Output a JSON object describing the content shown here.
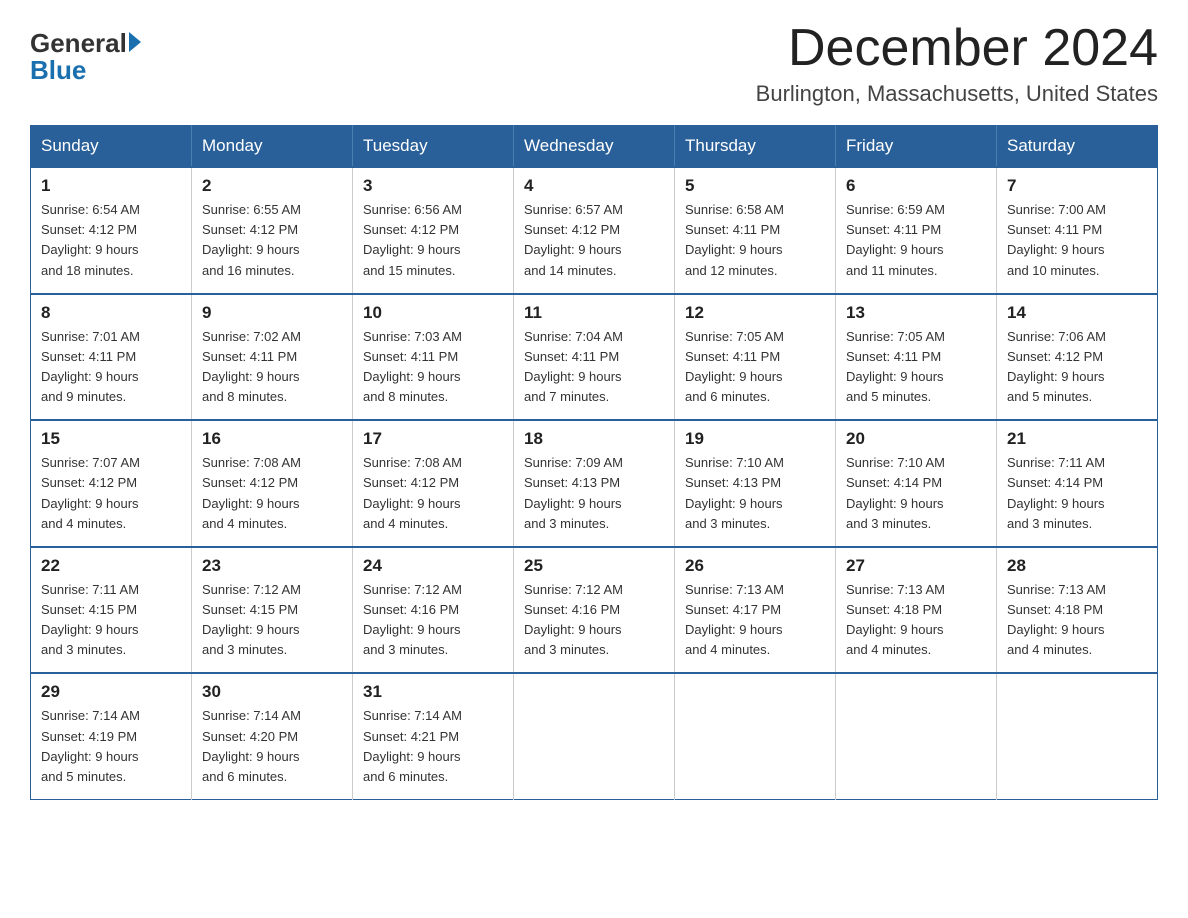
{
  "logo": {
    "general": "General",
    "blue": "Blue"
  },
  "title": "December 2024",
  "subtitle": "Burlington, Massachusetts, United States",
  "weekdays": [
    "Sunday",
    "Monday",
    "Tuesday",
    "Wednesday",
    "Thursday",
    "Friday",
    "Saturday"
  ],
  "weeks": [
    [
      {
        "day": "1",
        "sunrise": "6:54 AM",
        "sunset": "4:12 PM",
        "daylight": "9 hours and 18 minutes."
      },
      {
        "day": "2",
        "sunrise": "6:55 AM",
        "sunset": "4:12 PM",
        "daylight": "9 hours and 16 minutes."
      },
      {
        "day": "3",
        "sunrise": "6:56 AM",
        "sunset": "4:12 PM",
        "daylight": "9 hours and 15 minutes."
      },
      {
        "day": "4",
        "sunrise": "6:57 AM",
        "sunset": "4:12 PM",
        "daylight": "9 hours and 14 minutes."
      },
      {
        "day": "5",
        "sunrise": "6:58 AM",
        "sunset": "4:11 PM",
        "daylight": "9 hours and 12 minutes."
      },
      {
        "day": "6",
        "sunrise": "6:59 AM",
        "sunset": "4:11 PM",
        "daylight": "9 hours and 11 minutes."
      },
      {
        "day": "7",
        "sunrise": "7:00 AM",
        "sunset": "4:11 PM",
        "daylight": "9 hours and 10 minutes."
      }
    ],
    [
      {
        "day": "8",
        "sunrise": "7:01 AM",
        "sunset": "4:11 PM",
        "daylight": "9 hours and 9 minutes."
      },
      {
        "day": "9",
        "sunrise": "7:02 AM",
        "sunset": "4:11 PM",
        "daylight": "9 hours and 8 minutes."
      },
      {
        "day": "10",
        "sunrise": "7:03 AM",
        "sunset": "4:11 PM",
        "daylight": "9 hours and 8 minutes."
      },
      {
        "day": "11",
        "sunrise": "7:04 AM",
        "sunset": "4:11 PM",
        "daylight": "9 hours and 7 minutes."
      },
      {
        "day": "12",
        "sunrise": "7:05 AM",
        "sunset": "4:11 PM",
        "daylight": "9 hours and 6 minutes."
      },
      {
        "day": "13",
        "sunrise": "7:05 AM",
        "sunset": "4:11 PM",
        "daylight": "9 hours and 5 minutes."
      },
      {
        "day": "14",
        "sunrise": "7:06 AM",
        "sunset": "4:12 PM",
        "daylight": "9 hours and 5 minutes."
      }
    ],
    [
      {
        "day": "15",
        "sunrise": "7:07 AM",
        "sunset": "4:12 PM",
        "daylight": "9 hours and 4 minutes."
      },
      {
        "day": "16",
        "sunrise": "7:08 AM",
        "sunset": "4:12 PM",
        "daylight": "9 hours and 4 minutes."
      },
      {
        "day": "17",
        "sunrise": "7:08 AM",
        "sunset": "4:12 PM",
        "daylight": "9 hours and 4 minutes."
      },
      {
        "day": "18",
        "sunrise": "7:09 AM",
        "sunset": "4:13 PM",
        "daylight": "9 hours and 3 minutes."
      },
      {
        "day": "19",
        "sunrise": "7:10 AM",
        "sunset": "4:13 PM",
        "daylight": "9 hours and 3 minutes."
      },
      {
        "day": "20",
        "sunrise": "7:10 AM",
        "sunset": "4:14 PM",
        "daylight": "9 hours and 3 minutes."
      },
      {
        "day": "21",
        "sunrise": "7:11 AM",
        "sunset": "4:14 PM",
        "daylight": "9 hours and 3 minutes."
      }
    ],
    [
      {
        "day": "22",
        "sunrise": "7:11 AM",
        "sunset": "4:15 PM",
        "daylight": "9 hours and 3 minutes."
      },
      {
        "day": "23",
        "sunrise": "7:12 AM",
        "sunset": "4:15 PM",
        "daylight": "9 hours and 3 minutes."
      },
      {
        "day": "24",
        "sunrise": "7:12 AM",
        "sunset": "4:16 PM",
        "daylight": "9 hours and 3 minutes."
      },
      {
        "day": "25",
        "sunrise": "7:12 AM",
        "sunset": "4:16 PM",
        "daylight": "9 hours and 3 minutes."
      },
      {
        "day": "26",
        "sunrise": "7:13 AM",
        "sunset": "4:17 PM",
        "daylight": "9 hours and 4 minutes."
      },
      {
        "day": "27",
        "sunrise": "7:13 AM",
        "sunset": "4:18 PM",
        "daylight": "9 hours and 4 minutes."
      },
      {
        "day": "28",
        "sunrise": "7:13 AM",
        "sunset": "4:18 PM",
        "daylight": "9 hours and 4 minutes."
      }
    ],
    [
      {
        "day": "29",
        "sunrise": "7:14 AM",
        "sunset": "4:19 PM",
        "daylight": "9 hours and 5 minutes."
      },
      {
        "day": "30",
        "sunrise": "7:14 AM",
        "sunset": "4:20 PM",
        "daylight": "9 hours and 6 minutes."
      },
      {
        "day": "31",
        "sunrise": "7:14 AM",
        "sunset": "4:21 PM",
        "daylight": "9 hours and 6 minutes."
      },
      null,
      null,
      null,
      null
    ]
  ],
  "labels": {
    "sunrise": "Sunrise:",
    "sunset": "Sunset:",
    "daylight": "Daylight:"
  }
}
